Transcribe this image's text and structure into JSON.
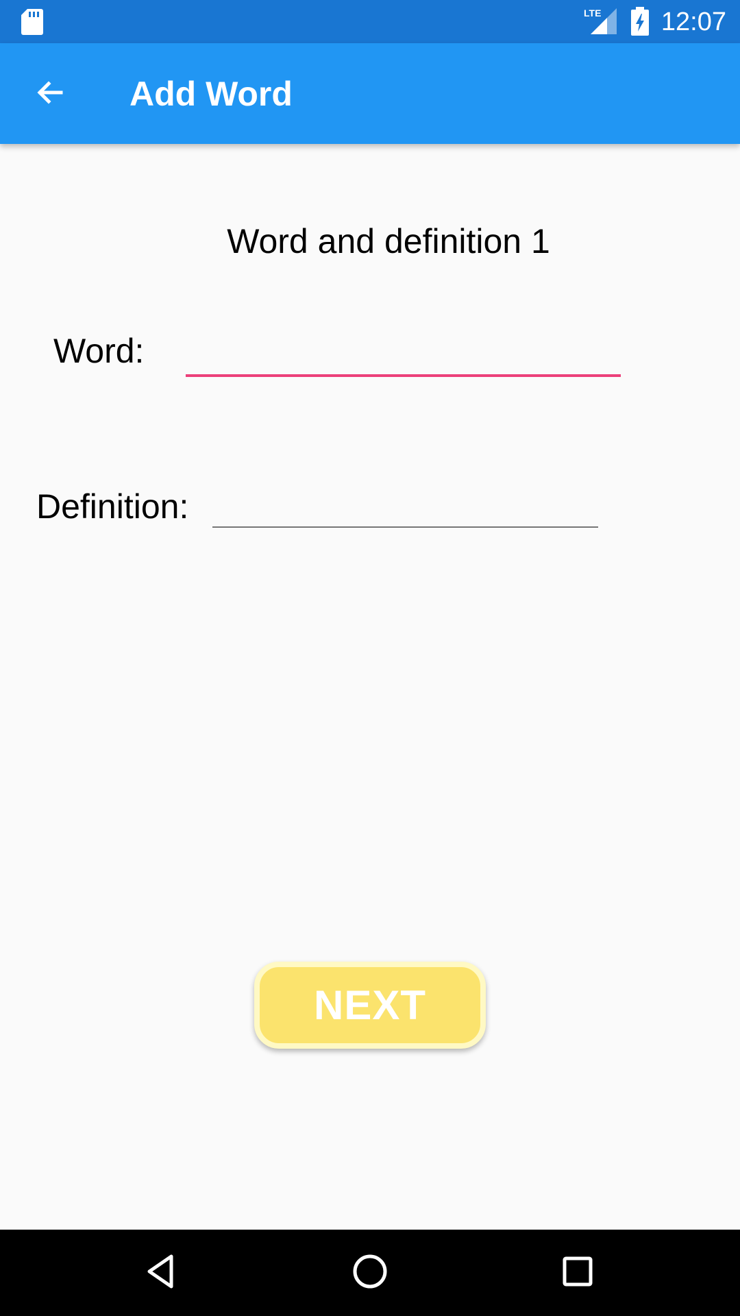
{
  "status_bar": {
    "time": "12:07",
    "icons": [
      "sd-card-icon",
      "lte-signal-icon",
      "battery-charging-icon"
    ]
  },
  "app_bar": {
    "title": "Add Word",
    "back_icon": "arrow-back-icon"
  },
  "form": {
    "heading": "Word and definition 1",
    "word_label": "Word:",
    "word_value": "",
    "definition_label": "Definition:",
    "definition_value": ""
  },
  "actions": {
    "next_label": "NEXT"
  },
  "nav_bar": {
    "buttons": [
      "nav-back-icon",
      "nav-home-icon",
      "nav-recents-icon"
    ]
  },
  "colors": {
    "status_bar": "#1976D2",
    "app_bar": "#2196F3",
    "accent_underline": "#EC407A",
    "button_fill": "#FBE36D",
    "button_border": "#FFF9C4",
    "background": "#FAFAFA"
  }
}
